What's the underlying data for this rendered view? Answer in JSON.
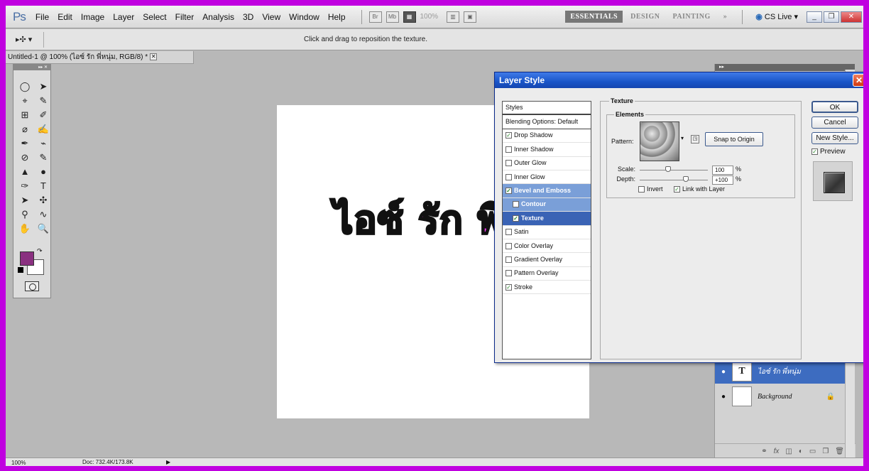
{
  "menubar": {
    "logo": "Ps",
    "items": [
      "File",
      "Edit",
      "Image",
      "Layer",
      "Select",
      "Filter",
      "Analysis",
      "3D",
      "View",
      "Window",
      "Help"
    ],
    "br_label": "Br",
    "mb_label": "Mb",
    "zoom_label": "100%",
    "workspaces": [
      "ESSENTIALS",
      "DESIGN",
      "PAINTING"
    ],
    "more": "»",
    "cslive": "CS Live"
  },
  "options": {
    "hint": "Click and drag to reposition the texture."
  },
  "document": {
    "tab_title": "Untitled-1 @ 100% (ไอซ์ รัก พี่หนุ่ม, RGB/8) *",
    "canvas_text": "ไอซ์ รัก พี่"
  },
  "toolbox": {
    "tools": [
      "◯",
      "➤",
      "⌖",
      "✎",
      "⊞",
      "✐",
      "⌀",
      "✍",
      "✒",
      "⌁",
      "⊘",
      "✎",
      "▲",
      "●",
      "✑",
      "T",
      "➤",
      "✣",
      "⚲",
      "∿",
      "✋",
      "🔍"
    ]
  },
  "colors": {
    "foreground": "#8a3080",
    "background": "#ffffff"
  },
  "status": {
    "zoom": "100%",
    "doc": "Doc: 732.4K/173.8K"
  },
  "layers": [
    {
      "name": "ไอซ์ รัก พี่หนุ่ม",
      "thumb": "T",
      "selected": true
    },
    {
      "name": "Background",
      "thumb": "",
      "selected": false
    }
  ],
  "dialog": {
    "title": "Layer Style",
    "styles_header": "Styles",
    "blending": "Blending Options: Default",
    "styles": [
      {
        "label": "Drop Shadow",
        "checked": true
      },
      {
        "label": "Inner Shadow",
        "checked": false
      },
      {
        "label": "Outer Glow",
        "checked": false
      },
      {
        "label": "Inner Glow",
        "checked": false
      },
      {
        "label": "Bevel and Emboss",
        "checked": true
      },
      {
        "label": "Contour",
        "checked": false
      },
      {
        "label": "Texture",
        "checked": true
      },
      {
        "label": "Satin",
        "checked": false
      },
      {
        "label": "Color Overlay",
        "checked": false
      },
      {
        "label": "Gradient Overlay",
        "checked": false
      },
      {
        "label": "Pattern Overlay",
        "checked": false
      },
      {
        "label": "Stroke",
        "checked": true
      }
    ],
    "section_title": "Texture",
    "group_title": "Elements",
    "pattern_label": "Pattern:",
    "snap_button": "Snap to Origin",
    "scale_label": "Scale:",
    "scale_value": "100",
    "scale_fraction": 0.42,
    "depth_label": "Depth:",
    "depth_value": "+100",
    "depth_fraction": 0.68,
    "percent": "%",
    "invert_label": "Invert",
    "invert_checked": false,
    "link_label": "Link with Layer",
    "link_checked": true,
    "buttons": {
      "ok": "OK",
      "cancel": "Cancel",
      "new_style": "New Style..."
    },
    "preview_label": "Preview",
    "preview_checked": true
  }
}
